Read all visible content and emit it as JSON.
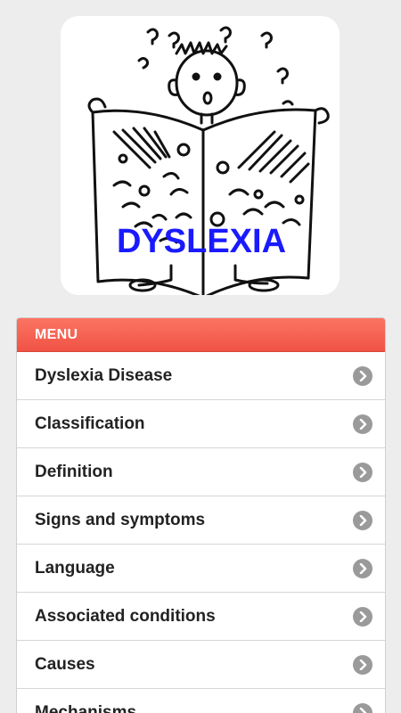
{
  "hero": {
    "image_label": "DYSLEXIA",
    "label_color": "#1a1aff"
  },
  "menu": {
    "header": "MENU",
    "header_color": "#f05a4a",
    "items": [
      {
        "label": "Dyslexia Disease",
        "icon": "chevron-right-icon"
      },
      {
        "label": "Classification",
        "icon": "chevron-right-icon"
      },
      {
        "label": "Definition",
        "icon": "chevron-right-icon"
      },
      {
        "label": "Signs and symptoms",
        "icon": "chevron-right-icon"
      },
      {
        "label": "Language",
        "icon": "chevron-right-icon"
      },
      {
        "label": "Associated conditions",
        "icon": "chevron-right-icon"
      },
      {
        "label": "Causes",
        "icon": "chevron-right-icon"
      },
      {
        "label": "Mechanisms",
        "icon": "chevron-right-icon"
      }
    ]
  }
}
